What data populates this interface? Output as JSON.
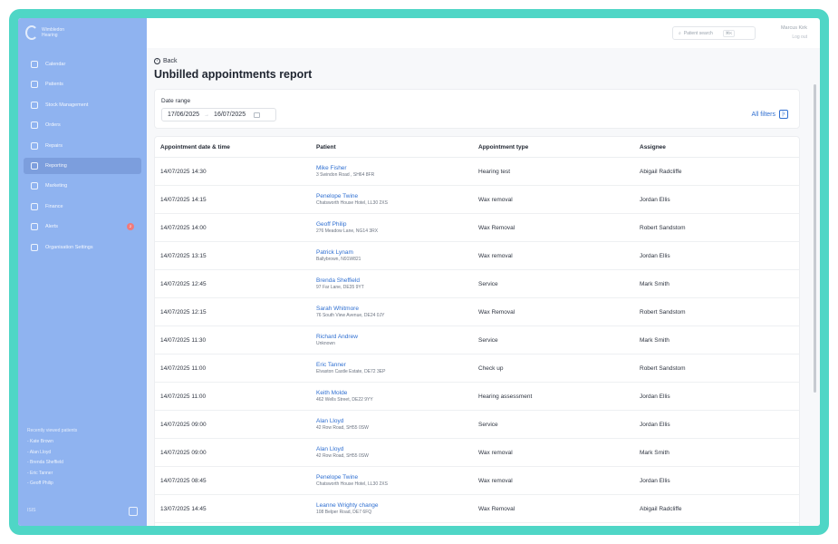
{
  "colors": {
    "frame": "#4fd6c6",
    "sidebar": "#8fb3f0",
    "link": "#2f6fd1",
    "badge": "#f07a7a"
  },
  "sidebar": {
    "brand": "Wimbledon Hearing",
    "items": [
      {
        "label": "Calendar",
        "icon": "calendar-icon"
      },
      {
        "label": "Patients",
        "icon": "user-icon"
      },
      {
        "label": "Stock Management",
        "icon": "box-icon"
      },
      {
        "label": "Orders",
        "icon": "orders-icon"
      },
      {
        "label": "Repairs",
        "icon": "wrench-icon"
      },
      {
        "label": "Reporting",
        "icon": "chart-icon",
        "active": true
      },
      {
        "label": "Marketing",
        "icon": "mail-icon"
      },
      {
        "label": "Finance",
        "icon": "finance-icon"
      },
      {
        "label": "Alerts",
        "icon": "bell-icon",
        "badge": "2"
      },
      {
        "label": "Organisation Settings",
        "icon": "gear-icon"
      }
    ],
    "recent_title": "Recently viewed patients",
    "recent": [
      "- Kate Brown",
      "- Alan Lloyd",
      "- Brenda Sheffield",
      "- Eric Tanner",
      "- Geoff Philip"
    ],
    "footer": "ISIS"
  },
  "topbar": {
    "search_placeholder": "Patient search",
    "search_shortcut": "⌘K",
    "user_name": "Marcus Kirk",
    "logout": "Log out"
  },
  "page": {
    "back": "Back",
    "title": "Unbilled appointments report"
  },
  "filters": {
    "date_label": "Date range",
    "date_from": "17/06/2025",
    "date_to": "16/07/2025",
    "all_filters": "All filters"
  },
  "table": {
    "headers": [
      "Appointment date & time",
      "Patient",
      "Appointment type",
      "Assignee"
    ],
    "rows": [
      {
        "datetime": "14/07/2025 14:30",
        "name": "Mike Fisher",
        "address": "3 Swindon Road , SH64 8FR",
        "type": "Hearing test",
        "assignee": "Abigail Radcliffe"
      },
      {
        "datetime": "14/07/2025 14:15",
        "name": "Penelope Twine",
        "address": "Chatsworth House Hotel, LL30 2XS",
        "type": "Wax removal",
        "assignee": "Jordan Ellis"
      },
      {
        "datetime": "14/07/2025 14:00",
        "name": "Geoff Philip",
        "address": "276 Meadow Lane, NG14 3RX",
        "type": "Wax Removal",
        "assignee": "Robert Sandstom"
      },
      {
        "datetime": "14/07/2025 13:15",
        "name": "Patrick Lynam",
        "address": "Ballybrown, N91W821",
        "type": "Wax removal",
        "assignee": "Jordan Ellis"
      },
      {
        "datetime": "14/07/2025 12:45",
        "name": "Brenda Sheffield",
        "address": "97 Far Lane, DE35 9YT",
        "type": "Service",
        "assignee": "Mark Smith"
      },
      {
        "datetime": "14/07/2025 12:15",
        "name": "Sarah Whitmore",
        "address": "76 South View Avenue, DE24 0JY",
        "type": "Wax Removal",
        "assignee": "Robert Sandstom"
      },
      {
        "datetime": "14/07/2025 11:30",
        "name": "Richard Andrew",
        "address": "Unknown",
        "type": "Service",
        "assignee": "Mark Smith"
      },
      {
        "datetime": "14/07/2025 11:00",
        "name": "Eric Tanner",
        "address": "Elvaston Castle Estate, DE72 3EP",
        "type": "Check up",
        "assignee": "Robert Sandstom"
      },
      {
        "datetime": "14/07/2025 11:00",
        "name": "Keith Molde",
        "address": "462 Wells Street, DE22 9YY",
        "type": "Hearing assessment",
        "assignee": "Jordan Ellis"
      },
      {
        "datetime": "14/07/2025 09:00",
        "name": "Alan Lloyd",
        "address": "42 Row Road, SH55 0SW",
        "type": "Service",
        "assignee": "Jordan Ellis"
      },
      {
        "datetime": "14/07/2025 09:00",
        "name": "Alan Lloyd",
        "address": "42 Row Road, SH55 0SW",
        "type": "Wax removal",
        "assignee": "Mark Smith"
      },
      {
        "datetime": "14/07/2025 08:45",
        "name": "Penelope Twine",
        "address": "Chatsworth House Hotel, LL30 2XS",
        "type": "Wax removal",
        "assignee": "Jordan Ellis"
      },
      {
        "datetime": "13/07/2025 14:45",
        "name": "Leanne Wrighty change",
        "address": "108 Belper Road, DE7 6FQ",
        "type": "Wax Removal",
        "assignee": "Abigail Radcliffe"
      }
    ]
  }
}
